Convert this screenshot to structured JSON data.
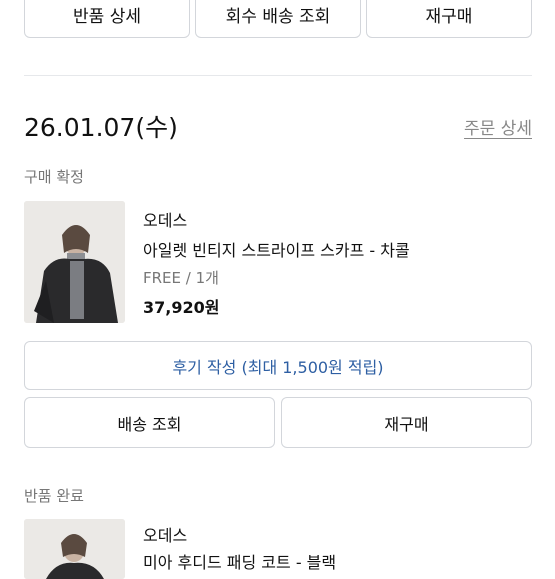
{
  "top_actions": {
    "return_detail": "반품 상세",
    "return_tracking": "회수 배송 조회",
    "reorder": "재구매"
  },
  "order": {
    "date": "26.01.07(수)",
    "detail_link": "주문 상세"
  },
  "items": [
    {
      "status": "구매 확정",
      "brand": "오데스",
      "name": "아일렛 빈티지 스트라이프 스카프 - 차콜",
      "option": "FREE / 1개",
      "price": "37,920원",
      "review_button": "후기 작성 (최대 1,500원 적립)",
      "shipping_button": "배송 조회",
      "reorder_button": "재구매"
    },
    {
      "status": "반품 완료",
      "brand": "오데스",
      "name": "미아 후디드 패딩 코트 - 블랙"
    }
  ],
  "colors": {
    "accent_blue": "#2e5fa3",
    "border": "#d3d6db",
    "muted_text": "#777777"
  }
}
